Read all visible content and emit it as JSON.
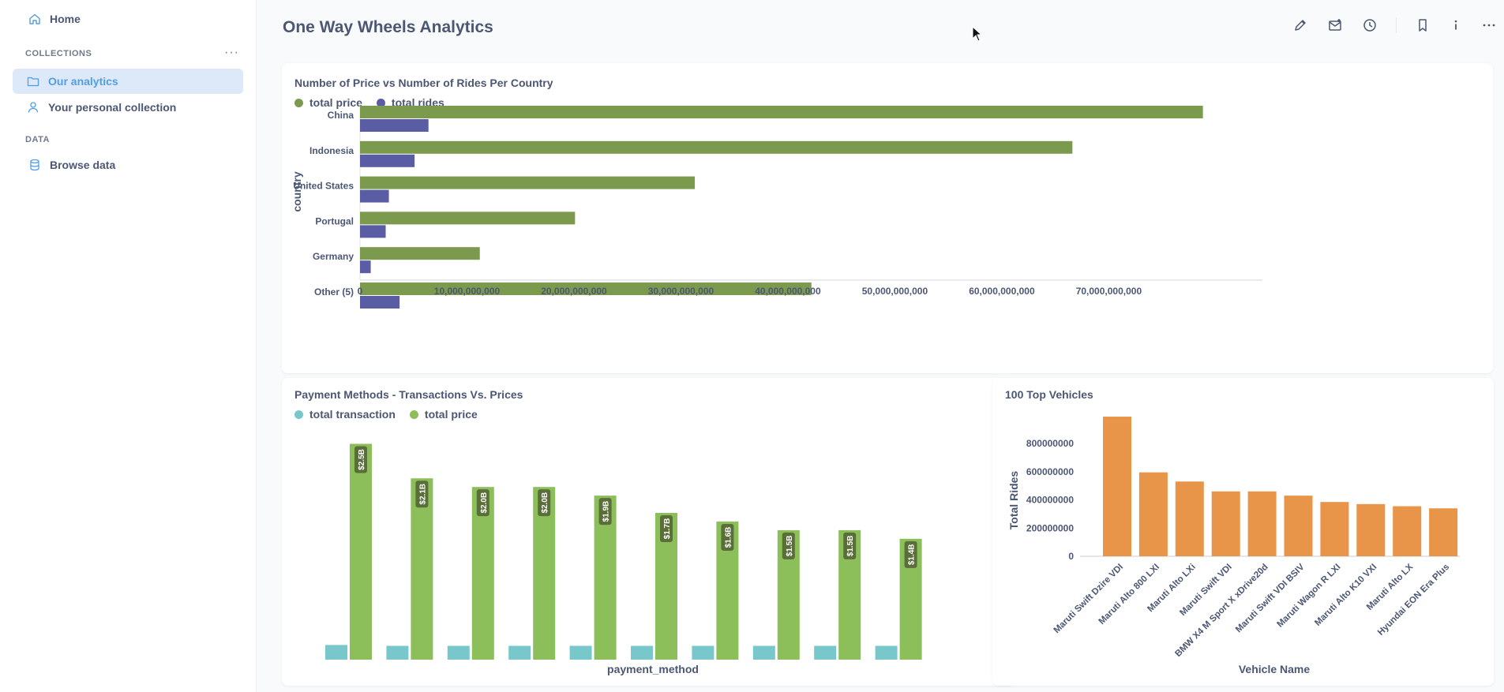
{
  "sidebar": {
    "home_label": "Home",
    "collections_heading": "COLLECTIONS",
    "collections": [
      {
        "label": "Our analytics",
        "icon": "folder-icon",
        "active": true
      },
      {
        "label": "Your personal collection",
        "icon": "person-icon",
        "active": false
      }
    ],
    "data_heading": "DATA",
    "browse_label": "Browse data"
  },
  "header": {
    "title": "One Way Wheels Analytics",
    "icons": [
      "pencil-icon",
      "subscription-icon",
      "clock-icon",
      "bookmark-icon",
      "info-icon",
      "more-icon"
    ]
  },
  "colors": {
    "green": "#7c9a4e",
    "navy": "#5b5da4",
    "teal": "#78c7cb",
    "light_green": "#8cbf59",
    "orange": "#e8954a",
    "accent": "#509ee3"
  },
  "chart_data": [
    {
      "type": "bar",
      "orientation": "horizontal",
      "title": "Number of Price vs Number of Rides Per Country",
      "ylabel": "country",
      "xlabel": "",
      "categories": [
        "China",
        "Indonesia",
        "United States",
        "Portugal",
        "Germany",
        "Other (5)"
      ],
      "series": [
        {
          "name": "total price",
          "values": [
            78800000,
            66600000,
            31300000,
            20100000,
            11200000,
            42200000
          ]
        },
        {
          "name": "total rides",
          "values": [
            6400000,
            5100000,
            2700000,
            2400000,
            1000000,
            3700000
          ]
        }
      ],
      "xlim": [
        0,
        82000000
      ],
      "xticks": [
        0,
        10000000,
        20000000,
        30000000,
        40000000,
        50000000,
        60000000,
        70000000
      ],
      "xtick_labels": [
        "0",
        "10,000,000,000",
        "20,000,000,000",
        "30,000,000,000",
        "40,000,000,000",
        "50,000,000,000",
        "60,000,000,000",
        "70,000,000,000"
      ],
      "legend": "top-left"
    },
    {
      "type": "bar",
      "title": "Payment Methods - Transactions Vs. Prices",
      "xlabel": "payment_method",
      "ylabel": "",
      "categories": [
        "",
        "",
        "",
        "",
        "",
        "",
        "",
        "",
        "",
        ""
      ],
      "series": [
        {
          "name": "total transaction",
          "values": [
            0.17,
            0.16,
            0.16,
            0.16,
            0.16,
            0.16,
            0.16,
            0.16,
            0.16,
            0.16
          ]
        },
        {
          "name": "total price",
          "values": [
            2.5,
            2.1,
            2.0,
            2.0,
            1.9,
            1.7,
            1.6,
            1.5,
            1.5,
            1.4
          ],
          "labels": [
            "$2.5B",
            "$2.1B",
            "$2.0B",
            "$2.0B",
            "$1.9B",
            "$1.7B",
            "$1.6B",
            "$1.5B",
            "$1.5B",
            "$1.4B"
          ]
        }
      ],
      "ylim": [
        0,
        2.55
      ],
      "legend": "top-left"
    },
    {
      "type": "bar",
      "title": "100 Top Vehicles",
      "xlabel": "Vehicle Name",
      "ylabel": "Total Rides",
      "categories": [
        "Maruti Swift Dzire VDI",
        "Maruti Alto 800 LXI",
        "Maruti Alto LXi",
        "Maruti Swift VDI",
        "BMW X4 M Sport X xDrive20d",
        "Maruti Swift VDI BSIV",
        "Maruti Wagon R LXI",
        "Maruti Alto K10 VXI",
        "Maruti Alto LX",
        "Hyundai EON Era Plus"
      ],
      "values": [
        990000000,
        595000000,
        530000000,
        460000000,
        460000000,
        430000000,
        385000000,
        370000000,
        355000000,
        340000000
      ],
      "yticks": [
        0,
        200000000,
        400000000,
        600000000,
        800000000
      ],
      "ytick_labels": [
        "0",
        "200000000",
        "400000000",
        "600000000",
        "800000000"
      ],
      "ylim": [
        0,
        1000000000
      ]
    }
  ]
}
